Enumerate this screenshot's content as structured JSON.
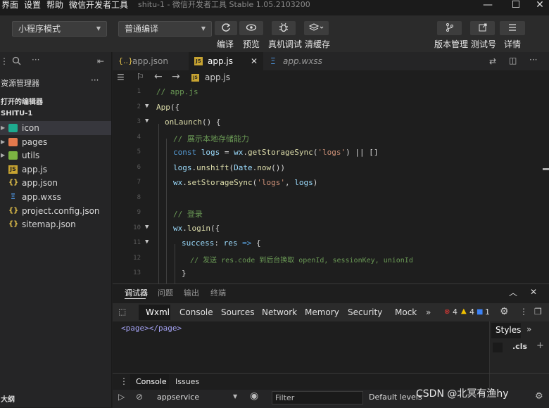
{
  "menu": {
    "items": [
      "界面",
      "设置",
      "帮助",
      "微信开发者工具"
    ],
    "window_title": "shitu-1 - 微信开发者工具 Stable 1.05.2103200"
  },
  "toolbar": {
    "mode_select": "小程序模式",
    "compile_select": "普通编译",
    "buttons": {
      "compile": "编译",
      "preview": "预览",
      "real_debug": "真机调试",
      "clear_cache": "清缓存",
      "version": "版本管理",
      "test_account": "测试号",
      "details": "详情"
    }
  },
  "sidebar": {
    "explorer_title": "资源管理器",
    "open_editors": "打开的编辑器",
    "project": "SHITU-1",
    "items": [
      {
        "label": "icon",
        "type": "folder"
      },
      {
        "label": "pages",
        "type": "folder"
      },
      {
        "label": "utils",
        "type": "folder"
      },
      {
        "label": "app.js",
        "type": "js"
      },
      {
        "label": "app.json",
        "type": "json"
      },
      {
        "label": "app.wxss",
        "type": "wxss"
      },
      {
        "label": "project.config.json",
        "type": "json"
      },
      {
        "label": "sitemap.json",
        "type": "json"
      }
    ],
    "outline": "大纲"
  },
  "editor": {
    "tabs": [
      "app.json",
      "app.js",
      "app.wxss"
    ],
    "breadcrumb": "app.js",
    "lines": [
      {
        "n": "1",
        "t": "// app.js"
      },
      {
        "n": "2",
        "t": "App({"
      },
      {
        "n": "3",
        "t": "onLaunch() {"
      },
      {
        "n": "4",
        "t": "// 展示本地存储能力"
      },
      {
        "n": "5",
        "t": "const logs = wx.getStorageSync('logs') || []"
      },
      {
        "n": "6",
        "t": "logs.unshift(Date.now())"
      },
      {
        "n": "7",
        "t": "wx.setStorageSync('logs', logs)"
      },
      {
        "n": "8",
        "t": ""
      },
      {
        "n": "9",
        "t": "// 登录"
      },
      {
        "n": "10",
        "t": "wx.login({"
      },
      {
        "n": "11",
        "t": "success: res => {"
      },
      {
        "n": "12",
        "t": "// 发送 res.code 到后台换取 openId, sessionKey, unionId"
      },
      {
        "n": "13",
        "t": "}"
      }
    ]
  },
  "panel": {
    "tabs": [
      "调试器",
      "问题",
      "输出",
      "终端"
    ],
    "devtools_tabs": [
      "Wxml",
      "Console",
      "Sources",
      "Network",
      "Memory",
      "Security",
      "Mock"
    ],
    "more": "»",
    "counts": {
      "errors": "4",
      "warnings": "4",
      "info": "1"
    },
    "wxml": "<page></page>",
    "styles_tab": "Styles",
    "cls": ".cls",
    "drawer_tabs": [
      "Console",
      "Issues"
    ],
    "context": "appservice",
    "filter_placeholder": "Filter",
    "levels": "Default levels",
    "watermark": "CSDN @北冥有渔hy"
  },
  "colors": {
    "background": "#1e1e1e",
    "sidebar": "#252526",
    "accent": "#007acc",
    "comment": "#6a9955",
    "keyword": "#569cd6",
    "string": "#ce9178",
    "function": "#dcdcaa"
  }
}
